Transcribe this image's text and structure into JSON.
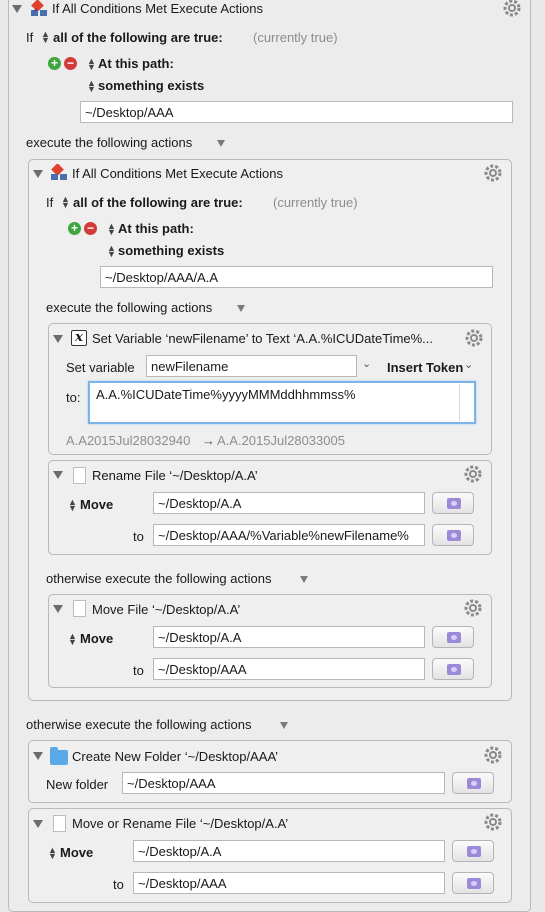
{
  "outer": {
    "title": "If All Conditions Met Execute Actions",
    "if_label": "If",
    "condition_mode": "all of the following are true:",
    "condition_status": "(currently true)",
    "path_type": "At this path:",
    "path_test": "something exists",
    "path_value": "~/Desktop/AAA",
    "execute_label": "execute the following actions",
    "otherwise_label": "otherwise execute the following actions"
  },
  "inner": {
    "title": "If All Conditions Met Execute Actions",
    "if_label": "If",
    "condition_mode": "all of the following are true:",
    "condition_status": "(currently true)",
    "path_type": "At this path:",
    "path_test": "something exists",
    "path_value": "~/Desktop/AAA/A.A",
    "execute_label": "execute the following actions",
    "otherwise_label": "otherwise execute the following actions"
  },
  "set_variable": {
    "title": "Set Variable ‘newFilename’ to Text ‘A.A.%ICUDateTime%...",
    "set_label": "Set variable",
    "variable_name": "newFilename",
    "insert_token": "Insert Token",
    "to_label": "to:",
    "to_value": "A.A.%ICUDateTime%yyyyMMMddhhmmss%",
    "preview_from": "A.A2015Jul28032940",
    "preview_arrow": "→",
    "preview_to": "A.A.2015Jul28033005"
  },
  "rename_file": {
    "title": "Rename File ‘~/Desktop/A.A’",
    "mode": "Move",
    "source": "~/Desktop/A.A",
    "to_label": "to",
    "destination": "~/Desktop/AAA/%Variable%newFilename%"
  },
  "move_file": {
    "title": "Move File ‘~/Desktop/A.A’",
    "mode": "Move",
    "source": "~/Desktop/A.A",
    "to_label": "to",
    "destination": "~/Desktop/AAA"
  },
  "create_folder": {
    "title": "Create New Folder ‘~/Desktop/AAA’",
    "label": "New folder",
    "value": "~/Desktop/AAA"
  },
  "move_or_rename": {
    "title": "Move or Rename File ‘~/Desktop/A.A’",
    "mode": "Move",
    "source": "~/Desktop/A.A",
    "to_label": "to",
    "destination": "~/Desktop/AAA"
  },
  "icons": [
    "gear-icon",
    "disclosure-triangle-icon",
    "plus-icon",
    "minus-icon",
    "folder-picker-icon",
    "document-icon",
    "folder-icon",
    "variable-icon",
    "if-then-icon"
  ]
}
